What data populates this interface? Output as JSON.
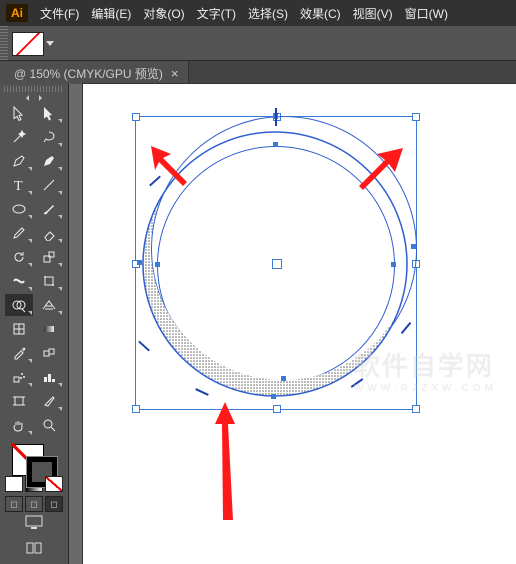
{
  "app": {
    "logo": "Ai"
  },
  "menu": {
    "file": "文件(F)",
    "edit": "编辑(E)",
    "object": "对象(O)",
    "type": "文字(T)",
    "select": "选择(S)",
    "effect": "效果(C)",
    "view": "视图(V)",
    "window": "窗口(W)"
  },
  "tab": {
    "title": "@ 150% (CMYK/GPU 预览)",
    "close": "×"
  },
  "watermark": {
    "line1": "软件自学网",
    "line2": "WWW.RJZXW.COM"
  },
  "tools": {
    "selection": "selection",
    "direct": "direct-select",
    "magic": "magic-wand",
    "lasso": "lasso",
    "pen": "pen",
    "curv": "curvature",
    "type": "type",
    "lineseg": "line-segment",
    "rect": "rectangle",
    "brush": "paintbrush",
    "shaper": "shaper",
    "eraser": "eraser",
    "rotate": "rotate",
    "scale": "scale",
    "width": "width",
    "free": "free-transform",
    "shape": "shape-builder",
    "persp": "perspective",
    "mesh": "mesh",
    "gradient": "gradient",
    "eyedrop": "eyedropper",
    "blend": "blend",
    "symbol": "symbol-spray",
    "graph": "column-graph",
    "artb": "artboard",
    "slice": "slice",
    "hand": "hand",
    "zoom": "zoom"
  }
}
